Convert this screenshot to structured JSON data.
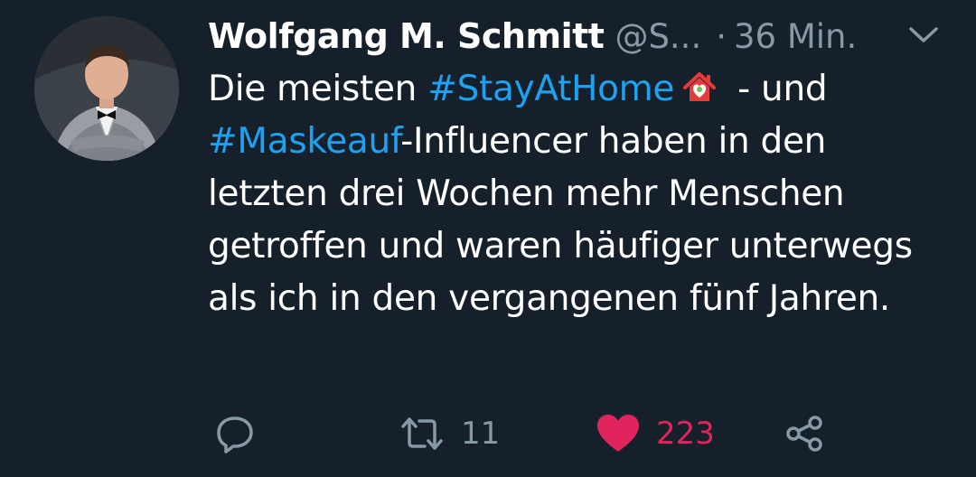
{
  "author": {
    "display_name": "Wolfgang M. Schmitt",
    "handle": "@S...",
    "separator": "·",
    "time": "36 Min."
  },
  "tweet": {
    "segments": {
      "s1": "Die meisten ",
      "hashtag1": "#StayAtHome",
      "s2": " - und",
      "hashtag2": "#Maskeauf",
      "s3": "-Influencer haben in den letzten drei Wochen mehr Menschen getroffen und waren häufiger unterwegs als ich in den vergangenen fünf Jahren."
    },
    "emoji": "house-with-heart-emoji"
  },
  "actions": {
    "reply_icon": "reply-icon",
    "retweet_icon": "retweet-icon",
    "retweet_count": "11",
    "like_icon": "heart-icon",
    "like_count": "223",
    "share_icon": "share-icon"
  },
  "colors": {
    "background": "#15202b",
    "text": "#ffffff",
    "muted": "#8899a6",
    "link": "#1da1f2",
    "like": "#e0245e"
  }
}
